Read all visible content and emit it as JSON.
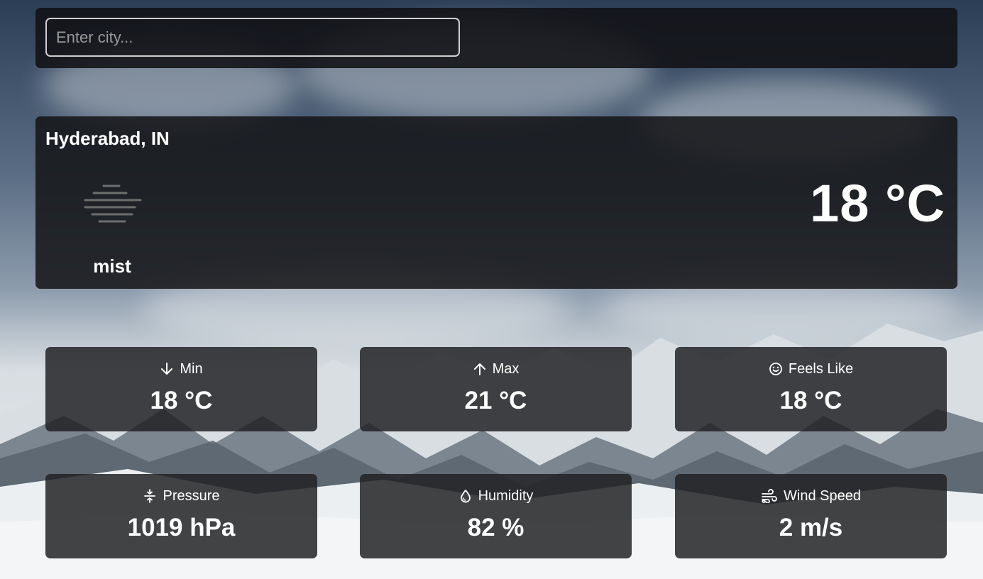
{
  "search": {
    "placeholder": "Enter city..."
  },
  "current": {
    "city": "Hyderabad, IN",
    "condition": "mist",
    "condition_icon": "mist-icon",
    "temperature": "18 °C"
  },
  "stats": [
    {
      "label": "Min",
      "value": "18 °C",
      "icon": "arrow-down-icon"
    },
    {
      "label": "Max",
      "value": "21 °C",
      "icon": "arrow-up-icon"
    },
    {
      "label": "Feels Like",
      "value": "18 °C",
      "icon": "smile-icon"
    },
    {
      "label": "Pressure",
      "value": "1019 hPa",
      "icon": "pressure-icon"
    },
    {
      "label": "Humidity",
      "value": "82 %",
      "icon": "droplet-icon"
    },
    {
      "label": "Wind Speed",
      "value": "2 m/s",
      "icon": "wind-icon"
    }
  ]
}
